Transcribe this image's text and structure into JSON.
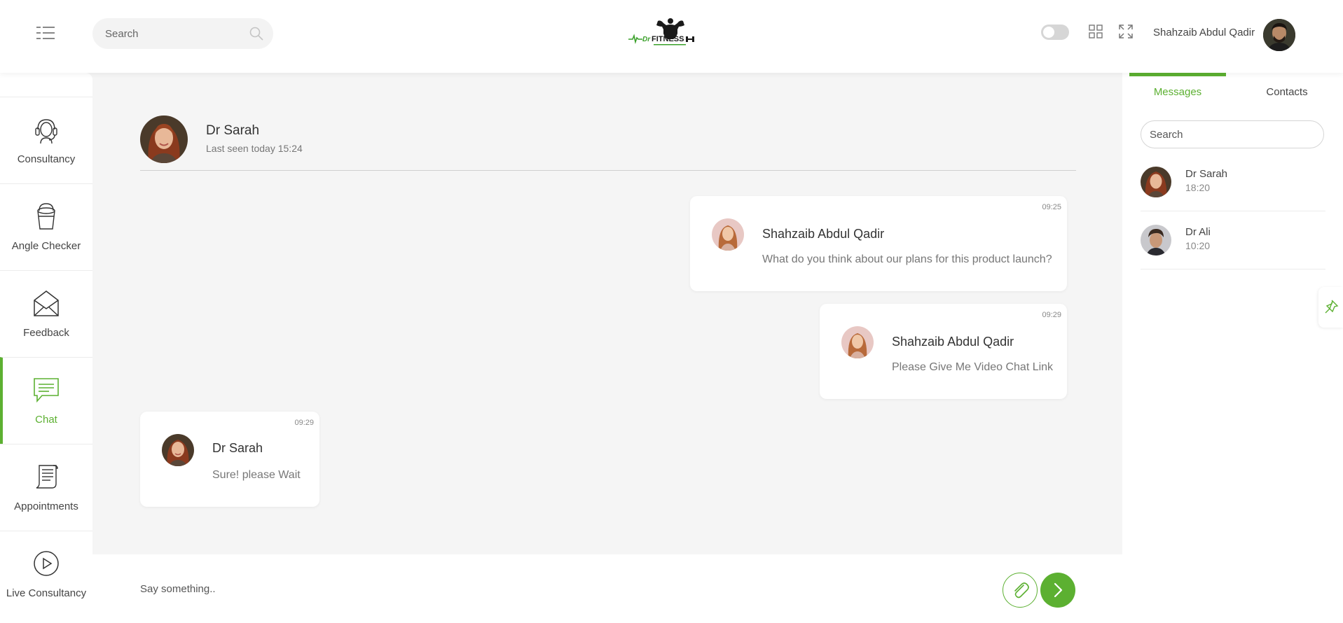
{
  "header": {
    "search_placeholder": "Search",
    "user_name": "Shahzaib Abdul Qadir",
    "logo_alt": "Dr FITNESS"
  },
  "sidebar": {
    "items": [
      {
        "label": "Consultancy",
        "icon": "headset-icon"
      },
      {
        "label": "Angle Checker",
        "icon": "bucket-icon"
      },
      {
        "label": "Feedback",
        "icon": "envelope-open-icon"
      },
      {
        "label": "Chat",
        "icon": "chat-bubble-icon",
        "active": true
      },
      {
        "label": "Appointments",
        "icon": "scroll-icon"
      },
      {
        "label": "Live Consultancy",
        "icon": "play-circle-icon"
      }
    ]
  },
  "chat": {
    "contact_name": "Dr Sarah",
    "last_seen": "Last seen today 15:24",
    "messages": [
      {
        "sender": "Shahzaib Abdul Qadir",
        "text": "What do you think about our plans for this product launch?",
        "time": "09:25"
      },
      {
        "sender": "Shahzaib Abdul Qadir",
        "text": "Please Give Me Video Chat Link",
        "time": "09:29"
      },
      {
        "sender": "Dr Sarah",
        "text": "Sure! please Wait",
        "time": "09:29"
      }
    ],
    "input_placeholder": "Say something.."
  },
  "rpanel": {
    "tabs": [
      "Messages",
      "Contacts"
    ],
    "search_placeholder": "Search",
    "contacts": [
      {
        "name": "Dr Sarah",
        "time": "18:20"
      },
      {
        "name": "Dr Ali",
        "time": "10:20"
      }
    ]
  },
  "colors": {
    "accent": "#5cb031",
    "background": "#f5f5f5"
  }
}
